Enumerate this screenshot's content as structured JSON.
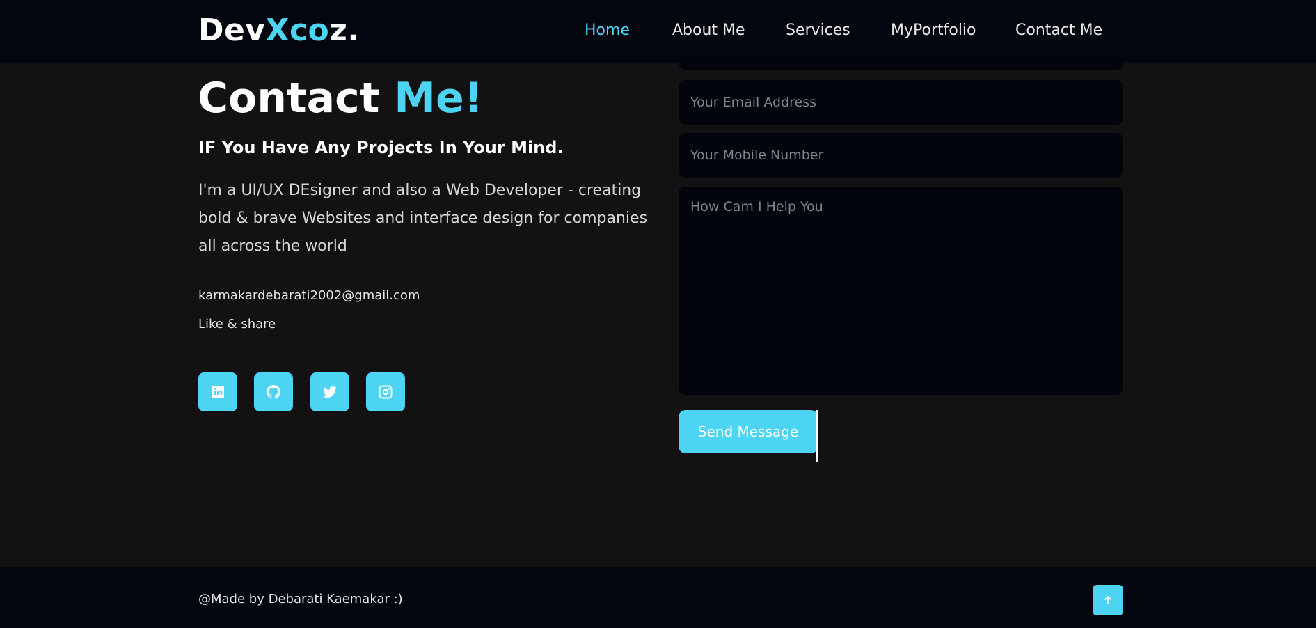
{
  "brand": {
    "logo_prefix": "Dev",
    "logo_accent": "Xco",
    "logo_suffix": "z."
  },
  "nav": {
    "items": [
      {
        "label": "Home",
        "active": true
      },
      {
        "label": "About Me"
      },
      {
        "label": "Services"
      },
      {
        "label": "MyPortfolio"
      },
      {
        "label": "Contact Me"
      }
    ]
  },
  "contact": {
    "title_main": "Contact",
    "title_accent": "Me!",
    "subtitle": "IF You Have Any Projects In Your Mind.",
    "bio": "I'm a UI/UX DEsigner and also a Web Developer - creating bold & brave Websites and interface design for companies all across the world",
    "email": "karmakardebarati2002@gmail.com",
    "share_text": "Like & share",
    "social_icons": [
      "linkedin-icon",
      "github-icon",
      "twitter-icon",
      "instagram-icon"
    ]
  },
  "form": {
    "email_placeholder": "Your Email Address",
    "mobile_placeholder": "Your Mobile Number",
    "message_placeholder": "How Cam I Help You",
    "send_label": "Send Message"
  },
  "footer": {
    "credit": "@Made by Debarati Kaemakar :)",
    "top_icon": "arrow-up-icon"
  },
  "colors": {
    "accent": "#4cd4f2",
    "background": "#121212",
    "header_bg": "#04060f",
    "field_bg": "#03050c"
  }
}
